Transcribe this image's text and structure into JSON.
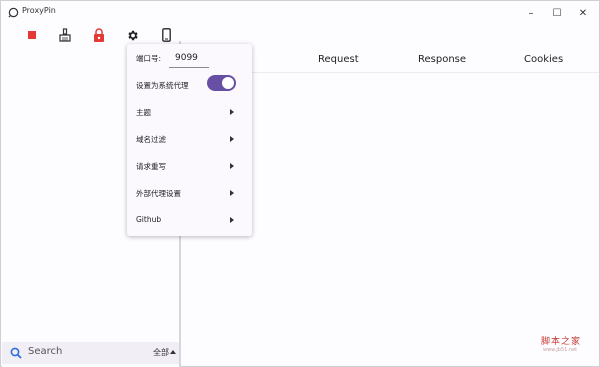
{
  "window": {
    "title": "ProxyPin",
    "controls": [
      "–",
      "☐",
      "✕"
    ]
  },
  "toolbar": {
    "buttons": [
      {
        "name": "stop-icon",
        "color": "#e53935"
      },
      {
        "name": "broom-icon",
        "color": "#333333"
      },
      {
        "name": "lock-icon",
        "color": "#e53935"
      },
      {
        "name": "gear-icon",
        "color": "#333333"
      },
      {
        "name": "phone-icon",
        "color": "#333333"
      }
    ]
  },
  "settings_menu": {
    "port_label": "端口号:",
    "port_value": "9099",
    "system_proxy_label": "设置为系统代理",
    "system_proxy_enabled": true,
    "items": [
      {
        "label": "主题"
      },
      {
        "label": "域名过滤"
      },
      {
        "label": "请求重写"
      },
      {
        "label": "外部代理设置"
      },
      {
        "label": "Github"
      }
    ]
  },
  "tabs": {
    "request": "Request",
    "response": "Response",
    "cookies": "Cookies"
  },
  "search": {
    "placeholder": "Search",
    "scope": "全部"
  },
  "watermark": {
    "main": "脚本之家",
    "sub": "www.jb51.net"
  },
  "colors": {
    "accent": "#6750a4",
    "danger": "#e53935"
  }
}
